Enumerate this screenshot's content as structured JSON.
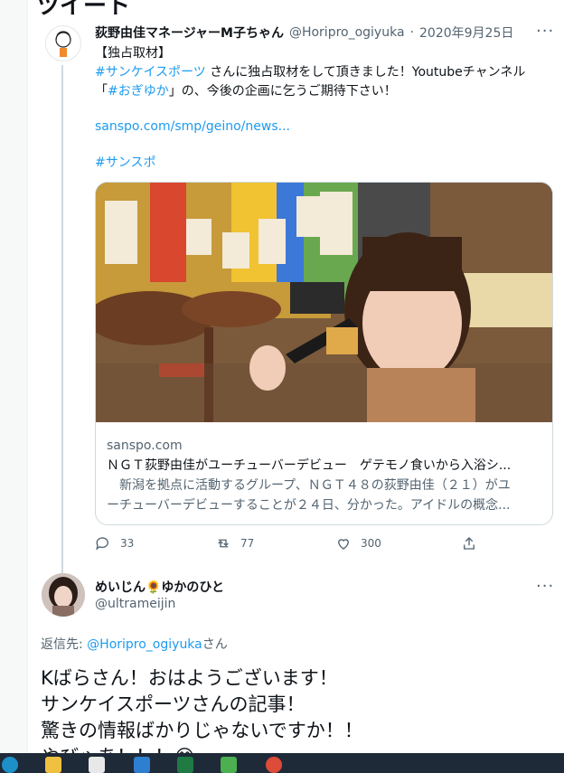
{
  "header": {
    "title": "ツイート"
  },
  "tweet": {
    "author_name": "荻野由佳マネージャーM子ちゃん",
    "handle": "@Horipro_ogiyuka",
    "dot": "·",
    "date": "2020年9月25日",
    "more": "···",
    "line1": "【独占取材】",
    "line2_link": "#サンケイスポーツ",
    "line2_rest": " さんに独占取材をして頂きました！Youtubeチャンネル",
    "line3_pre": "「",
    "line3_link": "#おぎゆか",
    "line3_rest": "」の、今後の企画に乞うご期待下さい！",
    "url": "sanspo.com/smp/geino/news...",
    "hashtag": "#サンスポ",
    "card": {
      "domain": "sanspo.com",
      "title": "ＮＧＴ荻野由佳がユーチューバーデビュー　ゲテモノ食いから入浴シ...",
      "desc1": "　新潟を拠点に活動するグループ、ＮＧＴ４８の荻野由佳（２１）がユ",
      "desc2": "ーチューバーデビューすることが２４日、分かった。アイドルの概念..."
    },
    "actions": {
      "replies": "33",
      "retweets": "77",
      "likes": "300"
    }
  },
  "reply": {
    "author_name": "めいじん🌻ゆかのひと",
    "handle": "@ultrameijin",
    "more": "···",
    "reply_to_prefix": "返信先: ",
    "reply_to_handle": "@Horipro_ogiyuka",
    "reply_to_suffix": "さん",
    "text": [
      "Kばらさん！おはようございます！",
      "サンケイスポーツさんの記事！",
      "驚きの情報ばかりじゃないですか！！",
      "やびゃあ！！！😂"
    ]
  },
  "taskbar": {
    "icons": [
      "edge-icon",
      "file-explorer-icon",
      "store-icon",
      "mail-icon",
      "excel-icon",
      "app-icon",
      "chrome-icon"
    ],
    "colors": {
      "bg": "#1f2a38",
      "accent": "#1d9bf0"
    }
  }
}
